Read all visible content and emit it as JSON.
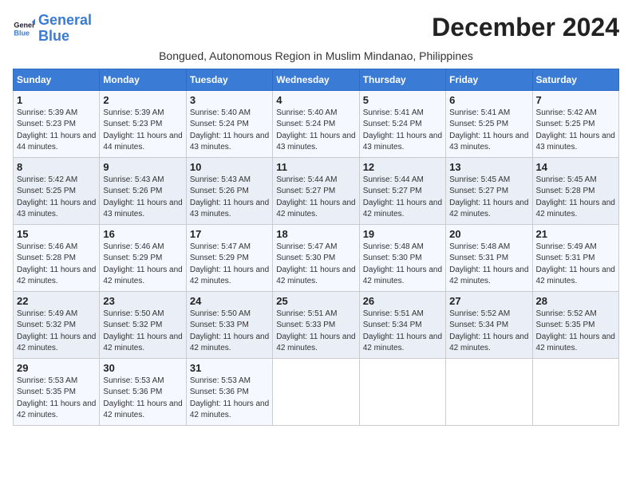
{
  "logo": {
    "line1": "General",
    "line2": "Blue"
  },
  "title": "December 2024",
  "location": "Bongued, Autonomous Region in Muslim Mindanao, Philippines",
  "days_of_week": [
    "Sunday",
    "Monday",
    "Tuesday",
    "Wednesday",
    "Thursday",
    "Friday",
    "Saturday"
  ],
  "weeks": [
    [
      {
        "day": "1",
        "sunrise": "5:39 AM",
        "sunset": "5:23 PM",
        "daylight": "11 hours and 44 minutes"
      },
      {
        "day": "2",
        "sunrise": "5:39 AM",
        "sunset": "5:23 PM",
        "daylight": "11 hours and 44 minutes"
      },
      {
        "day": "3",
        "sunrise": "5:40 AM",
        "sunset": "5:24 PM",
        "daylight": "11 hours and 43 minutes"
      },
      {
        "day": "4",
        "sunrise": "5:40 AM",
        "sunset": "5:24 PM",
        "daylight": "11 hours and 43 minutes"
      },
      {
        "day": "5",
        "sunrise": "5:41 AM",
        "sunset": "5:24 PM",
        "daylight": "11 hours and 43 minutes"
      },
      {
        "day": "6",
        "sunrise": "5:41 AM",
        "sunset": "5:25 PM",
        "daylight": "11 hours and 43 minutes"
      },
      {
        "day": "7",
        "sunrise": "5:42 AM",
        "sunset": "5:25 PM",
        "daylight": "11 hours and 43 minutes"
      }
    ],
    [
      {
        "day": "8",
        "sunrise": "5:42 AM",
        "sunset": "5:25 PM",
        "daylight": "11 hours and 43 minutes"
      },
      {
        "day": "9",
        "sunrise": "5:43 AM",
        "sunset": "5:26 PM",
        "daylight": "11 hours and 43 minutes"
      },
      {
        "day": "10",
        "sunrise": "5:43 AM",
        "sunset": "5:26 PM",
        "daylight": "11 hours and 43 minutes"
      },
      {
        "day": "11",
        "sunrise": "5:44 AM",
        "sunset": "5:27 PM",
        "daylight": "11 hours and 42 minutes"
      },
      {
        "day": "12",
        "sunrise": "5:44 AM",
        "sunset": "5:27 PM",
        "daylight": "11 hours and 42 minutes"
      },
      {
        "day": "13",
        "sunrise": "5:45 AM",
        "sunset": "5:27 PM",
        "daylight": "11 hours and 42 minutes"
      },
      {
        "day": "14",
        "sunrise": "5:45 AM",
        "sunset": "5:28 PM",
        "daylight": "11 hours and 42 minutes"
      }
    ],
    [
      {
        "day": "15",
        "sunrise": "5:46 AM",
        "sunset": "5:28 PM",
        "daylight": "11 hours and 42 minutes"
      },
      {
        "day": "16",
        "sunrise": "5:46 AM",
        "sunset": "5:29 PM",
        "daylight": "11 hours and 42 minutes"
      },
      {
        "day": "17",
        "sunrise": "5:47 AM",
        "sunset": "5:29 PM",
        "daylight": "11 hours and 42 minutes"
      },
      {
        "day": "18",
        "sunrise": "5:47 AM",
        "sunset": "5:30 PM",
        "daylight": "11 hours and 42 minutes"
      },
      {
        "day": "19",
        "sunrise": "5:48 AM",
        "sunset": "5:30 PM",
        "daylight": "11 hours and 42 minutes"
      },
      {
        "day": "20",
        "sunrise": "5:48 AM",
        "sunset": "5:31 PM",
        "daylight": "11 hours and 42 minutes"
      },
      {
        "day": "21",
        "sunrise": "5:49 AM",
        "sunset": "5:31 PM",
        "daylight": "11 hours and 42 minutes"
      }
    ],
    [
      {
        "day": "22",
        "sunrise": "5:49 AM",
        "sunset": "5:32 PM",
        "daylight": "11 hours and 42 minutes"
      },
      {
        "day": "23",
        "sunrise": "5:50 AM",
        "sunset": "5:32 PM",
        "daylight": "11 hours and 42 minutes"
      },
      {
        "day": "24",
        "sunrise": "5:50 AM",
        "sunset": "5:33 PM",
        "daylight": "11 hours and 42 minutes"
      },
      {
        "day": "25",
        "sunrise": "5:51 AM",
        "sunset": "5:33 PM",
        "daylight": "11 hours and 42 minutes"
      },
      {
        "day": "26",
        "sunrise": "5:51 AM",
        "sunset": "5:34 PM",
        "daylight": "11 hours and 42 minutes"
      },
      {
        "day": "27",
        "sunrise": "5:52 AM",
        "sunset": "5:34 PM",
        "daylight": "11 hours and 42 minutes"
      },
      {
        "day": "28",
        "sunrise": "5:52 AM",
        "sunset": "5:35 PM",
        "daylight": "11 hours and 42 minutes"
      }
    ],
    [
      {
        "day": "29",
        "sunrise": "5:53 AM",
        "sunset": "5:35 PM",
        "daylight": "11 hours and 42 minutes"
      },
      {
        "day": "30",
        "sunrise": "5:53 AM",
        "sunset": "5:36 PM",
        "daylight": "11 hours and 42 minutes"
      },
      {
        "day": "31",
        "sunrise": "5:53 AM",
        "sunset": "5:36 PM",
        "daylight": "11 hours and 42 minutes"
      },
      null,
      null,
      null,
      null
    ]
  ]
}
